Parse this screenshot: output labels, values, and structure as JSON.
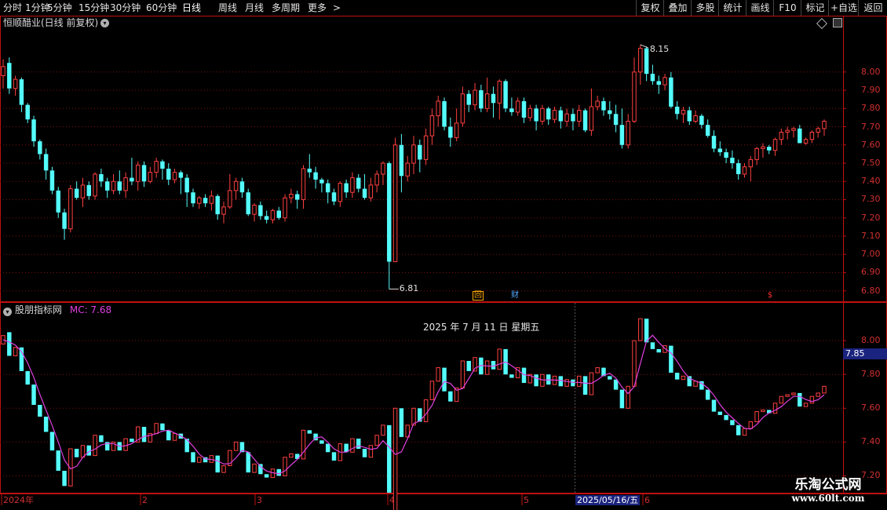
{
  "toolbar": {
    "left": [
      "分时",
      "1分钟",
      "5分钟",
      "15分钟",
      "30分钟",
      "60分钟",
      "日线",
      "周线",
      "月线",
      "多周期",
      "更多"
    ],
    "active": "日线",
    "more_arrow": ">",
    "right": [
      "复权",
      "叠加",
      "多股",
      "统计",
      "画线",
      "F10",
      "标记",
      "+自选",
      "返回"
    ]
  },
  "main_panel": {
    "title": "恒顺醋业(日线 前复权)",
    "high_label": "8.15",
    "low_label": "6.81",
    "price_axis": [
      "8.00",
      "7.90",
      "7.80",
      "7.70",
      "7.60",
      "7.50",
      "7.40",
      "7.30",
      "7.20",
      "7.10",
      "7.00",
      "6.90",
      "6.80"
    ],
    "markers": [
      "回",
      "财",
      "$"
    ],
    "icons": [
      "diamond-icon",
      "settings-icon"
    ]
  },
  "sub_panel": {
    "title": "股朋指标网",
    "mc_text": "MC: 7.68",
    "date_text": "2025 年 7 月 11 日 星期五",
    "axis": [
      "8.00",
      "7.80",
      "7.60",
      "7.40",
      "7.20"
    ],
    "current_value": "7.85"
  },
  "x_axis": {
    "labels": [
      "2024年",
      "2",
      "3",
      "4",
      "5",
      "6"
    ],
    "highlight": "2025/05/16/五"
  },
  "watermark": {
    "name": "乐淘公式网",
    "url": "www.60lt.com"
  },
  "colors": {
    "up": "#ff4040",
    "down": "#54fcfc",
    "mc_line": "#e040e0",
    "axis": "#c01010",
    "grid": "#7a1010"
  },
  "chart_data": {
    "type": "candlestick",
    "ylim": [
      6.76,
      8.24
    ],
    "candles": [
      [
        7.98,
        8.03,
        7.91,
        8.07
      ],
      [
        8.05,
        7.91,
        7.88,
        8.08
      ],
      [
        7.91,
        7.96,
        7.87,
        7.98
      ],
      [
        7.96,
        7.82,
        7.78,
        7.97
      ],
      [
        7.82,
        7.74,
        7.72,
        7.83
      ],
      [
        7.74,
        7.62,
        7.59,
        7.76
      ],
      [
        7.62,
        7.55,
        7.52,
        7.63
      ],
      [
        7.55,
        7.46,
        7.41,
        7.58
      ],
      [
        7.46,
        7.35,
        7.33,
        7.48
      ],
      [
        7.35,
        7.23,
        7.2,
        7.37
      ],
      [
        7.23,
        7.14,
        7.08,
        7.25
      ],
      [
        7.14,
        7.36,
        7.12,
        7.38
      ],
      [
        7.36,
        7.31,
        7.3,
        7.4
      ],
      [
        7.31,
        7.38,
        7.26,
        7.42
      ],
      [
        7.38,
        7.32,
        7.3,
        7.4
      ],
      [
        7.32,
        7.44,
        7.3,
        7.45
      ],
      [
        7.44,
        7.4,
        7.37,
        7.47
      ],
      [
        7.4,
        7.35,
        7.31,
        7.42
      ],
      [
        7.35,
        7.4,
        7.33,
        7.44
      ],
      [
        7.4,
        7.35,
        7.33,
        7.46
      ],
      [
        7.35,
        7.42,
        7.31,
        7.45
      ],
      [
        7.42,
        7.4,
        7.38,
        7.53
      ],
      [
        7.4,
        7.49,
        7.35,
        7.51
      ],
      [
        7.49,
        7.4,
        7.37,
        7.51
      ],
      [
        7.4,
        7.45,
        7.39,
        7.48
      ],
      [
        7.45,
        7.51,
        7.42,
        7.53
      ],
      [
        7.51,
        7.47,
        7.41,
        7.52
      ],
      [
        7.47,
        7.41,
        7.38,
        7.5
      ],
      [
        7.41,
        7.45,
        7.39,
        7.47
      ],
      [
        7.45,
        7.42,
        7.33,
        7.46
      ],
      [
        7.42,
        7.34,
        7.26,
        7.44
      ],
      [
        7.34,
        7.28,
        7.26,
        7.36
      ],
      [
        7.28,
        7.31,
        7.25,
        7.32
      ],
      [
        7.31,
        7.28,
        7.26,
        7.33
      ],
      [
        7.28,
        7.32,
        7.24,
        7.35
      ],
      [
        7.32,
        7.22,
        7.19,
        7.33
      ],
      [
        7.22,
        7.26,
        7.17,
        7.29
      ],
      [
        7.26,
        7.35,
        7.25,
        7.44
      ],
      [
        7.35,
        7.4,
        7.3,
        7.42
      ],
      [
        7.4,
        7.34,
        7.31,
        7.42
      ],
      [
        7.34,
        7.22,
        7.21,
        7.36
      ],
      [
        7.22,
        7.27,
        7.18,
        7.28
      ],
      [
        7.27,
        7.21,
        7.19,
        7.29
      ],
      [
        7.21,
        7.19,
        7.17,
        7.24
      ],
      [
        7.19,
        7.24,
        7.17,
        7.25
      ],
      [
        7.24,
        7.2,
        7.19,
        7.26
      ],
      [
        7.2,
        7.31,
        7.18,
        7.33
      ],
      [
        7.31,
        7.33,
        7.28,
        7.36
      ],
      [
        7.33,
        7.3,
        7.25,
        7.35
      ],
      [
        7.3,
        7.47,
        7.25,
        7.49
      ],
      [
        7.47,
        7.45,
        7.42,
        7.55
      ],
      [
        7.45,
        7.41,
        7.36,
        7.48
      ],
      [
        7.41,
        7.39,
        7.34,
        7.42
      ],
      [
        7.39,
        7.34,
        7.28,
        7.41
      ],
      [
        7.34,
        7.29,
        7.27,
        7.36
      ],
      [
        7.29,
        7.39,
        7.26,
        7.4
      ],
      [
        7.39,
        7.34,
        7.31,
        7.41
      ],
      [
        7.34,
        7.42,
        7.31,
        7.45
      ],
      [
        7.42,
        7.36,
        7.34,
        7.44
      ],
      [
        7.36,
        7.31,
        7.3,
        7.44
      ],
      [
        7.31,
        7.38,
        7.29,
        7.42
      ],
      [
        7.38,
        7.44,
        7.34,
        7.46
      ],
      [
        7.44,
        7.5,
        7.38,
        7.51
      ],
      [
        7.5,
        6.96,
        6.81,
        7.51
      ],
      [
        6.96,
        7.6,
        6.96,
        7.64
      ],
      [
        7.6,
        7.43,
        7.34,
        7.66
      ],
      [
        7.43,
        7.5,
        7.4,
        7.54
      ],
      [
        7.5,
        7.6,
        7.44,
        7.65
      ],
      [
        7.6,
        7.52,
        7.45,
        7.63
      ],
      [
        7.52,
        7.65,
        7.49,
        7.69
      ],
      [
        7.65,
        7.76,
        7.6,
        7.8
      ],
      [
        7.76,
        7.84,
        7.7,
        7.87
      ],
      [
        7.84,
        7.7,
        7.68,
        7.86
      ],
      [
        7.7,
        7.64,
        7.59,
        7.75
      ],
      [
        7.64,
        7.72,
        7.62,
        7.8
      ],
      [
        7.72,
        7.88,
        7.7,
        7.92
      ],
      [
        7.88,
        7.82,
        7.78,
        7.9
      ],
      [
        7.82,
        7.9,
        7.79,
        7.94
      ],
      [
        7.9,
        7.8,
        7.78,
        7.93
      ],
      [
        7.8,
        7.88,
        7.78,
        7.97
      ],
      [
        7.88,
        7.83,
        7.75,
        7.92
      ],
      [
        7.83,
        7.95,
        7.74,
        7.96
      ],
      [
        7.95,
        7.8,
        7.78,
        7.96
      ],
      [
        7.8,
        7.78,
        7.76,
        7.86
      ],
      [
        7.78,
        7.84,
        7.76,
        7.86
      ],
      [
        7.84,
        7.75,
        7.72,
        7.86
      ],
      [
        7.75,
        7.8,
        7.73,
        7.82
      ],
      [
        7.8,
        7.73,
        7.68,
        7.82
      ],
      [
        7.73,
        7.8,
        7.71,
        7.82
      ],
      [
        7.8,
        7.74,
        7.71,
        7.81
      ],
      [
        7.74,
        7.79,
        7.72,
        7.81
      ],
      [
        7.79,
        7.73,
        7.69,
        7.81
      ],
      [
        7.73,
        7.77,
        7.7,
        7.8
      ],
      [
        7.77,
        7.73,
        7.68,
        7.8
      ],
      [
        7.73,
        7.79,
        7.7,
        7.82
      ],
      [
        7.79,
        7.68,
        7.67,
        7.8
      ],
      [
        7.68,
        7.81,
        7.65,
        7.91
      ],
      [
        7.81,
        7.84,
        7.79,
        7.87
      ],
      [
        7.84,
        7.79,
        7.76,
        7.86
      ],
      [
        7.79,
        7.77,
        7.74,
        7.84
      ],
      [
        7.77,
        7.71,
        7.67,
        7.82
      ],
      [
        7.71,
        7.6,
        7.58,
        7.8
      ],
      [
        7.6,
        7.73,
        7.58,
        7.77
      ],
      [
        7.73,
        8.0,
        7.72,
        8.08
      ],
      [
        8.0,
        8.13,
        7.93,
        8.15
      ],
      [
        8.13,
        7.99,
        7.95,
        8.14
      ],
      [
        7.99,
        7.95,
        7.93,
        8.04
      ],
      [
        7.95,
        7.93,
        7.88,
        7.98
      ],
      [
        7.93,
        7.97,
        7.9,
        7.99
      ],
      [
        7.97,
        7.81,
        7.8,
        8.0
      ],
      [
        7.81,
        7.77,
        7.74,
        7.84
      ],
      [
        7.77,
        7.79,
        7.72,
        7.81
      ],
      [
        7.79,
        7.73,
        7.71,
        7.81
      ],
      [
        7.73,
        7.76,
        7.72,
        7.79
      ],
      [
        7.76,
        7.71,
        7.69,
        7.77
      ],
      [
        7.71,
        7.65,
        7.64,
        7.74
      ],
      [
        7.65,
        7.58,
        7.56,
        7.68
      ],
      [
        7.58,
        7.56,
        7.54,
        7.62
      ],
      [
        7.56,
        7.53,
        7.5,
        7.58
      ],
      [
        7.53,
        7.5,
        7.47,
        7.57
      ],
      [
        7.5,
        7.44,
        7.41,
        7.52
      ],
      [
        7.44,
        7.48,
        7.42,
        7.5
      ],
      [
        7.48,
        7.52,
        7.4,
        7.54
      ],
      [
        7.52,
        7.58,
        7.49,
        7.59
      ],
      [
        7.58,
        7.59,
        7.53,
        7.61
      ],
      [
        7.59,
        7.57,
        7.55,
        7.6
      ],
      [
        7.57,
        7.63,
        7.54,
        7.64
      ],
      [
        7.63,
        7.67,
        7.6,
        7.69
      ],
      [
        7.67,
        7.68,
        7.63,
        7.7
      ],
      [
        7.68,
        7.69,
        7.64,
        7.7
      ],
      [
        7.69,
        7.61,
        7.61,
        7.71
      ],
      [
        7.61,
        7.63,
        7.6,
        7.64
      ],
      [
        7.63,
        7.67,
        7.61,
        7.68
      ],
      [
        7.67,
        7.69,
        7.64,
        7.7
      ],
      [
        7.69,
        7.73,
        7.65,
        7.74
      ]
    ]
  }
}
